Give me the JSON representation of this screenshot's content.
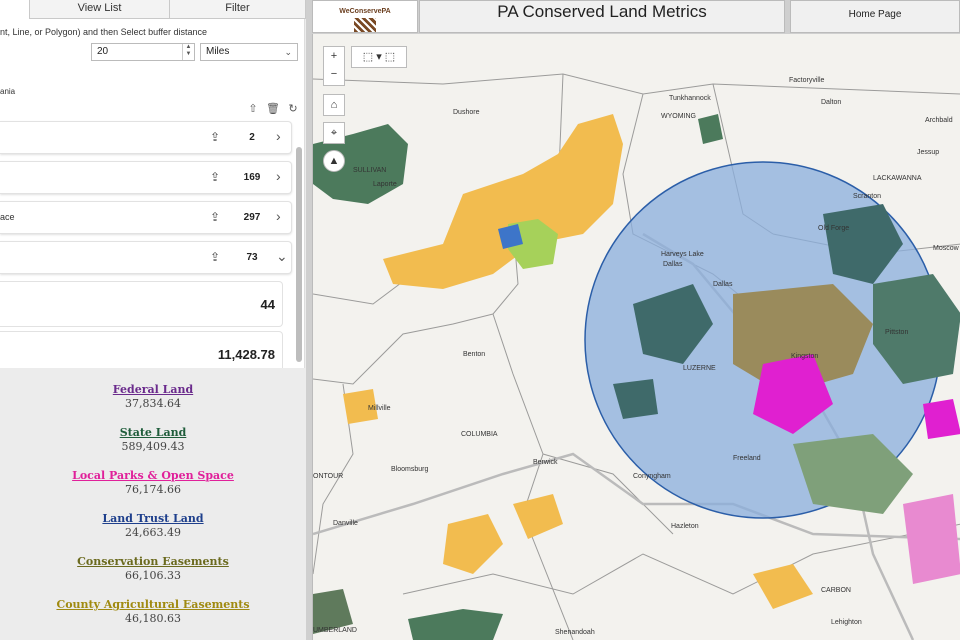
{
  "tabs": [
    {
      "label": ""
    },
    {
      "label": "View List"
    },
    {
      "label": "Filter"
    }
  ],
  "buffer": {
    "instruction": "nt, Line, or Polygon) and then Select buffer distance",
    "distance": "20",
    "units": "Miles",
    "area_text": "ania"
  },
  "categories": [
    {
      "name": "",
      "count": "2"
    },
    {
      "name": "",
      "count": "169"
    },
    {
      "name": "ace",
      "count": "297"
    },
    {
      "name": "",
      "count": "73"
    }
  ],
  "stats": [
    "44",
    "11,428.78"
  ],
  "legend": [
    {
      "title": "Federal Land",
      "value": "37,834.64",
      "color": "#6a2a8c"
    },
    {
      "title": "State Land",
      "value": "589,409.43",
      "color": "#1e5c3a"
    },
    {
      "title": "Local Parks & Open Space",
      "value": "76,174.66",
      "color": "#e0209a"
    },
    {
      "title": "Land Trust Land",
      "value": "24,663.49",
      "color": "#1e3f8c"
    },
    {
      "title": "Conservation Easements",
      "value": "66,106.33",
      "color": "#6b6a1e"
    },
    {
      "title": "County Agricultural Easements",
      "value": "46,180.63",
      "color": "#a08a10"
    }
  ],
  "header": {
    "logo_text": "WeConservePA",
    "title": "PA Conserved Land Metrics",
    "home": "Home Page"
  },
  "map": {
    "labels": [
      "Factoryville",
      "Tunkhannock",
      "Dalton",
      "Archbald",
      "Dushore",
      "WYOMING",
      "Jessup",
      "SULLIVAN",
      "Laporte",
      "LACKAWANNA",
      "Scranton",
      "Old Forge",
      "Moscow",
      "Harveys Lake",
      "Dallas",
      "Pittston",
      "Dallas",
      "Kingston",
      "LUZERNE",
      "Benton",
      "Millville",
      "COLUMBIA",
      "Berwick",
      "Bloomsburg",
      "Freeland",
      "Conyngham",
      "Hazleton",
      "Danville",
      "ONTOUR",
      "Shenandoah",
      "CARBON",
      "Lehighton",
      "UMBERLAND"
    ],
    "buffer_fill": "#8aaedc",
    "buffer_stroke": "#2b5ea8"
  }
}
